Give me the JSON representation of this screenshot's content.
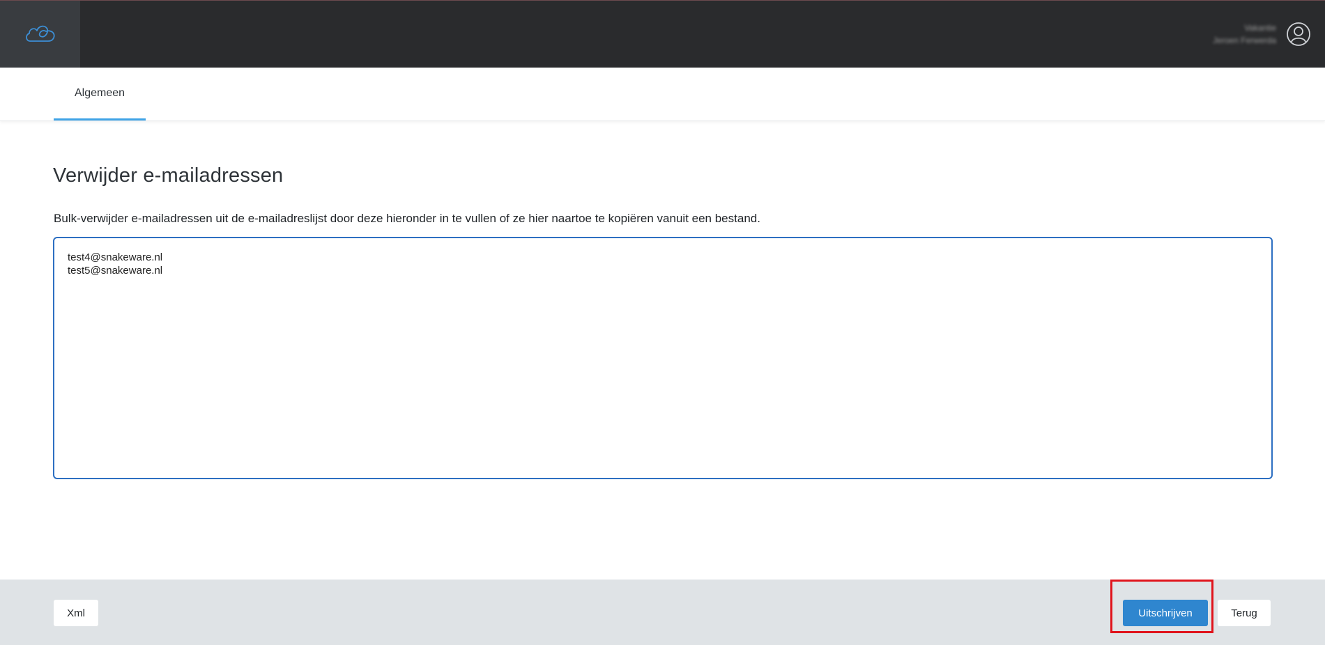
{
  "header": {
    "logo_icon": "cloud-icon",
    "user_name": "Vakantie",
    "user_org": "Jeroen Ferwerda",
    "avatar_icon": "user-circle-icon",
    "colors": {
      "bar": "#2a2b2d",
      "logo_bg": "#393c40",
      "logo_stroke": "#3c8fd6"
    }
  },
  "tabs": [
    {
      "label": "Algemeen",
      "active": true
    }
  ],
  "main": {
    "title": "Verwijder e-mailadressen",
    "description": "Bulk-verwijder e-mailadressen uit de e-mailadreslijst door deze hieronder in te vullen of ze hier naartoe te kopiëren vanuit een bestand.",
    "emails_value": "test4@snakeware.nl\ntest5@snakeware.nl"
  },
  "footer": {
    "xml_label": "Xml",
    "unsubscribe_label": "Uitschrijven",
    "back_label": "Terug",
    "colors": {
      "primary": "#2f86cf",
      "highlight": "#e0141c"
    }
  }
}
